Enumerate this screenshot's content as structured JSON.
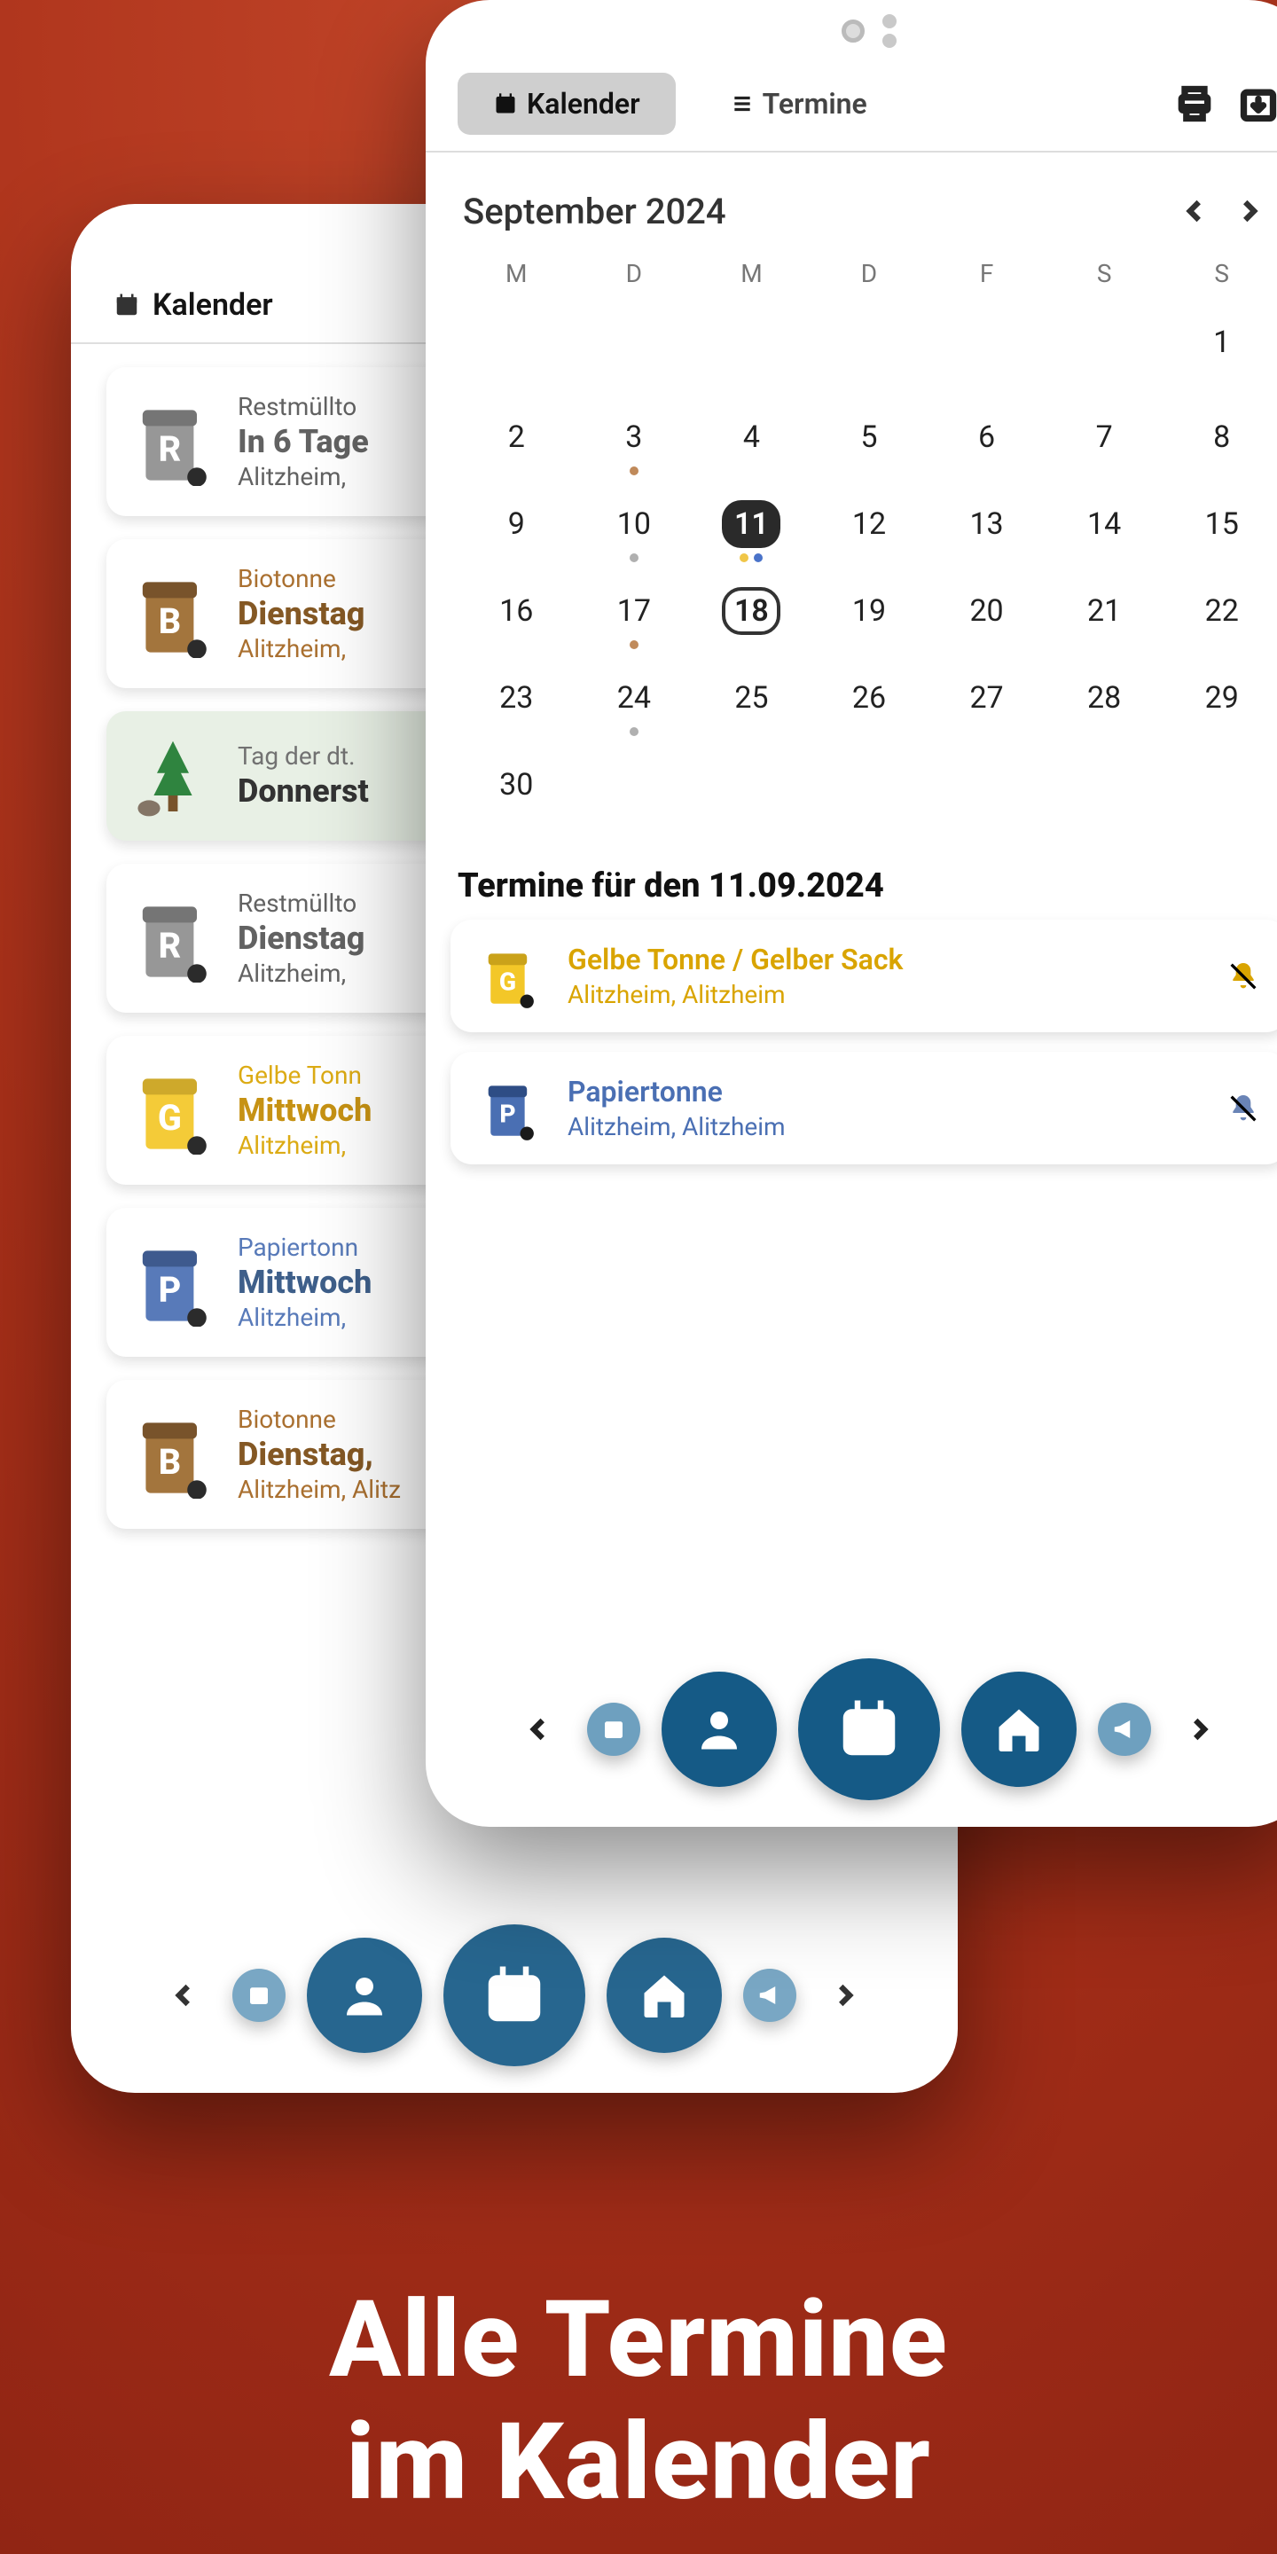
{
  "promo": {
    "line1": "Alle Termine",
    "line2": "im Kalender"
  },
  "front": {
    "tabs": {
      "calendar": "Kalender",
      "appointments": "Termine"
    },
    "calendar": {
      "month_label": "September 2024",
      "dow": [
        "M",
        "D",
        "M",
        "D",
        "F",
        "S",
        "S"
      ],
      "weeks": [
        [
          {
            "n": "",
            "empty": true
          },
          {
            "n": "",
            "empty": true
          },
          {
            "n": "",
            "empty": true
          },
          {
            "n": "",
            "empty": true
          },
          {
            "n": "",
            "empty": true
          },
          {
            "n": "",
            "empty": true
          },
          {
            "n": "1"
          }
        ],
        [
          {
            "n": "2"
          },
          {
            "n": "3",
            "dots": [
              "brown"
            ]
          },
          {
            "n": "4"
          },
          {
            "n": "5"
          },
          {
            "n": "6"
          },
          {
            "n": "7"
          },
          {
            "n": "8"
          }
        ],
        [
          {
            "n": "9"
          },
          {
            "n": "10",
            "dots": [
              "grey"
            ]
          },
          {
            "n": "11",
            "sel": true,
            "dots": [
              "yellow",
              "blue"
            ]
          },
          {
            "n": "12"
          },
          {
            "n": "13"
          },
          {
            "n": "14"
          },
          {
            "n": "15"
          }
        ],
        [
          {
            "n": "16"
          },
          {
            "n": "17",
            "dots": [
              "brown"
            ]
          },
          {
            "n": "18",
            "outlined": true
          },
          {
            "n": "19"
          },
          {
            "n": "20"
          },
          {
            "n": "21"
          },
          {
            "n": "22"
          }
        ],
        [
          {
            "n": "23"
          },
          {
            "n": "24",
            "dots": [
              "grey"
            ]
          },
          {
            "n": "25"
          },
          {
            "n": "26"
          },
          {
            "n": "27"
          },
          {
            "n": "28"
          },
          {
            "n": "29"
          }
        ],
        [
          {
            "n": "30"
          },
          {
            "n": "",
            "empty": true
          },
          {
            "n": "",
            "empty": true
          },
          {
            "n": "",
            "empty": true
          },
          {
            "n": "",
            "empty": true
          },
          {
            "n": "",
            "empty": true
          },
          {
            "n": "",
            "empty": true
          }
        ]
      ]
    },
    "section_title": "Termine für den 11.09.2024",
    "events": [
      {
        "kind": "yellow",
        "letter": "G",
        "title": "Gelbe Tonne / Gelber Sack",
        "sub": "Alitzheim, Alitzheim"
      },
      {
        "kind": "blue",
        "letter": "P",
        "title": "Papiertonne",
        "sub": "Alitzheim, Alitzheim"
      }
    ]
  },
  "back": {
    "title": "Kalender",
    "items": [
      {
        "kind": "grey",
        "letter": "R",
        "a": "Restmüllto",
        "b": "In 6 Tage",
        "c": "Alitzheim,"
      },
      {
        "kind": "brown",
        "letter": "B",
        "a": "Biotonne",
        "b": "Dienstag",
        "c": "Alitzheim,"
      },
      {
        "kind": "green",
        "letter": "",
        "a": "Tag der dt.",
        "b": "Donnerst",
        "c": ""
      },
      {
        "kind": "grey",
        "letter": "R",
        "a": "Restmüllto",
        "b": "Dienstag",
        "c": "Alitzheim,"
      },
      {
        "kind": "yellow",
        "letter": "G",
        "a": "Gelbe Tonn",
        "b": "Mittwoch",
        "c": "Alitzheim,"
      },
      {
        "kind": "blue",
        "letter": "P",
        "a": "Papiertonn",
        "b": "Mittwoch",
        "c": "Alitzheim,"
      },
      {
        "kind": "brown",
        "letter": "B",
        "a": "Biotonne",
        "b": "Dienstag,",
        "c": "Alitzheim, Alitz"
      }
    ]
  }
}
